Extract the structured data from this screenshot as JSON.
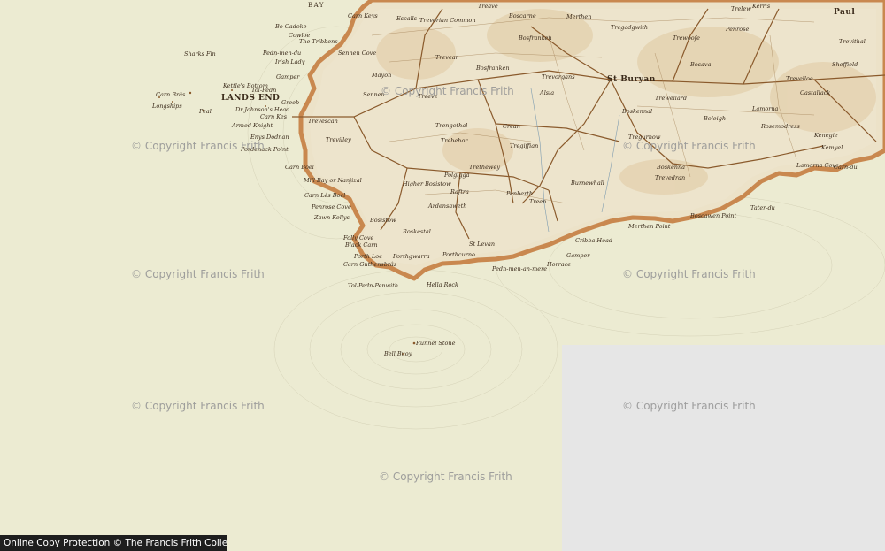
{
  "colors": {
    "sea": "#ecebd2",
    "land": "#ece2c8",
    "coast": "#c9884f",
    "roads": "#8a5a2c",
    "blank_area": "#e6e6e6",
    "protection_bar": "#1e1e1e",
    "watermark": "#969696"
  },
  "map": {
    "sea_labels": {
      "bay": "BAY",
      "lands_end": "LANDS END"
    },
    "place_labels": [
      "Carn Keys",
      "Bo Cadoke",
      "Cowloe",
      "The Tribbens",
      "Pedn-men-du",
      "Irish Lady",
      "Sennen Cove",
      "Mayon",
      "Sennen",
      "Sharks Fin",
      "Gamper",
      "Kettle's Bottom",
      "Longships",
      "Carn Brâs",
      "Peal",
      "Tol-Pedn",
      "Dr Johnson's Head",
      "Greeb",
      "Carn Kes",
      "Armed Knight",
      "Enys Dodnan",
      "Trevescan",
      "Trevilley",
      "Escalls",
      "Trevorian Common",
      "Treave",
      "Boscarne",
      "Trevear",
      "Bosfranken",
      "Trengothal",
      "Treeve",
      "Tregiffian",
      "Crean",
      "Trebehor",
      "Trethewey",
      "Porthgwarra",
      "Higher Bosistow",
      "Polgigga",
      "Raftra",
      "Ardensaweth",
      "Bosistow",
      "Roskestal",
      "Treen",
      "Penberth",
      "St Levan",
      "Porthcurno",
      "Porth Loe",
      "Folly Cove",
      "Black Carn",
      "Carn Guthensbrâs",
      "Tol-Pedn-Penwith",
      "Runnel Stone",
      "Bell Buoy",
      "Hella Rock",
      "Pedn-men-an-mere",
      "Horrace",
      "Cribba Head",
      "Gamper",
      "Mill Bay or Nanjizal",
      "Carn Lês Boel",
      "Pordenack Point",
      "Zawn Kellys",
      "Penrose Cove",
      "Carn Boel",
      "St Buryan",
      "Boskennal",
      "Bosfranken",
      "Alsia",
      "Trevorgans",
      "Trevedran",
      "Boskenna",
      "Burnewhall",
      "Merthen Point",
      "Boscawen Point",
      "Lamorna Cove",
      "Trelew",
      "Kerris",
      "Paul",
      "Castallack",
      "Trevithal",
      "Merthen",
      "Boleigh",
      "Lamorna",
      "Tregurnow",
      "Bosava",
      "Penrose",
      "Trewoofe",
      "Tregadgwith",
      "Trevelloe",
      "Rosemodress",
      "Kenegie",
      "Trewellard",
      "Sheffield",
      "Kemyel",
      "Carn-du",
      "Tater-du"
    ]
  },
  "watermarks": [
    "© Copyright Francis Frith",
    "© Copyright Francis Frith",
    "© Copyright Francis Frith",
    "© Copyright Francis Frith",
    "© Copyright Francis Frith",
    "© Copyright Francis Frith",
    "© Copyright Francis Frith",
    "© Copyright Francis Frith"
  ],
  "footer": {
    "protection_text": "Online Copy Protection © The Francis Frith Collection"
  }
}
